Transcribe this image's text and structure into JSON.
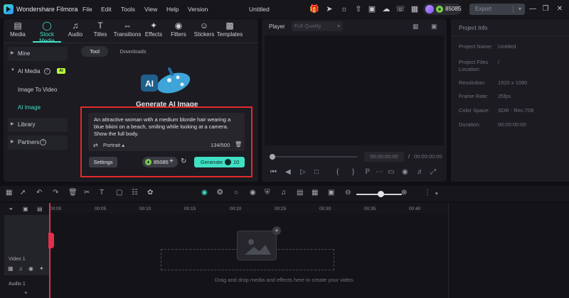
{
  "app": {
    "name": "Wondershare Filmora",
    "menu": [
      "File",
      "Edit",
      "Tools",
      "View",
      "Help",
      "Version"
    ],
    "document_title": "Untitled",
    "credits": "85085",
    "export_label": "Export",
    "accent_color": "#3fe0c4",
    "highlight_color": "#e22a2a"
  },
  "toolbar_tabs": [
    {
      "label": "Media",
      "icon": "media-icon"
    },
    {
      "label": "Stock Media",
      "icon": "stock-media-icon"
    },
    {
      "label": "Audio",
      "icon": "audio-icon"
    },
    {
      "label": "Titles",
      "icon": "titles-icon"
    },
    {
      "label": "Transitions",
      "icon": "transitions-icon"
    },
    {
      "label": "Effects",
      "icon": "effects-icon"
    },
    {
      "label": "Filters",
      "icon": "filters-icon"
    },
    {
      "label": "Stickers",
      "icon": "stickers-icon"
    },
    {
      "label": "Templates",
      "icon": "templates-icon"
    }
  ],
  "sidebar": {
    "mine": "Mine",
    "ai_media": "AI Media",
    "ai_badge": "AI",
    "image_to_video": "Image To Video",
    "ai_image": "AI Image",
    "library": "Library",
    "partners": "Partners"
  },
  "content": {
    "tab_tool": "Tool",
    "tab_downloads": "Downloads",
    "hero_badge": "AI",
    "hero_title": "Generate AI Image",
    "prompt": "An attractive woman with a medium blonde hair wearing a blue bikini on a beach, smiling while looking at a camera. Show the full body.",
    "ratio": "Portrait",
    "counter": "134/500",
    "settings_label": "Settings",
    "credits": "85085",
    "generate_label": "Generate",
    "generate_cost": "10"
  },
  "player": {
    "label": "Player",
    "quality": "Full Quality",
    "current_time": "00:00:00:00",
    "separator": "/",
    "total_time": "00:00:00:00"
  },
  "project_info": {
    "title": "Project Info",
    "rows": [
      {
        "label": "Project Name:",
        "value": "Untitled"
      },
      {
        "label": "Project Files Location:",
        "value": "/"
      },
      {
        "label": "Resolution:",
        "value": "1920 x 1080"
      },
      {
        "label": "Frame Rate:",
        "value": "25fps"
      },
      {
        "label": "Color Space:",
        "value": "SDR - Rec.709"
      },
      {
        "label": "Duration:",
        "value": "00:00:00:00"
      }
    ]
  },
  "timeline": {
    "ticks": [
      "00:00",
      "00:05",
      "00:10",
      "00:15",
      "00:20",
      "00:25",
      "00:30",
      "00:35",
      "00:40"
    ],
    "video_track": "Video 1",
    "audio_track": "Audio 1",
    "drop_hint": "Drag and drop media and effects here to create your video."
  }
}
